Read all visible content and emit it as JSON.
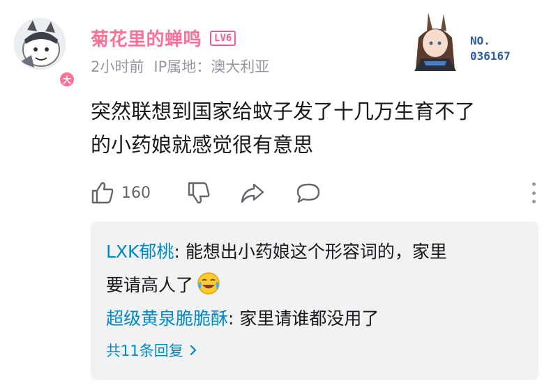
{
  "user": {
    "name": "菊花里的蝉鸣",
    "level": "LV6",
    "badge": "大",
    "time": "2小时前",
    "ip": "IP属地：澳大利亚"
  },
  "garb": {
    "label": "NO.",
    "number": "036167"
  },
  "comment": {
    "line1": "突然联想到国家给蚊子发了十几万生育不了",
    "line2": "的小药娘就感觉很有意思"
  },
  "actions": {
    "like_count": "160"
  },
  "replies": [
    {
      "name": "LXK郁桃",
      "line1": "能想出小药娘这个形容词的，家里",
      "line2": "要请高人了"
    },
    {
      "name": "超级黄泉脆脆酥",
      "text": "家里请谁都没用了"
    }
  ],
  "more_replies": "共11条回复",
  "colors": {
    "pink": "#fb7299",
    "blue": "#008ac5",
    "grey": "#9499a0",
    "reply_bg": "#f1f2f3"
  },
  "icons": [
    "thumbs-up-icon",
    "thumbs-down-icon",
    "share-icon",
    "comment-icon",
    "more-vertical-icon",
    "chevron-right-icon",
    "laugh-cry-emoji"
  ]
}
